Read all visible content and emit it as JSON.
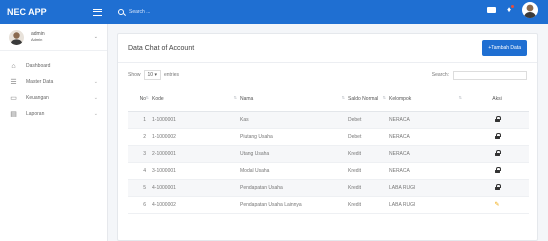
{
  "header": {
    "app_name": "NEC APP",
    "search_placeholder": "Search ..."
  },
  "user": {
    "name": "admin",
    "role": "Admin"
  },
  "sidebar": {
    "items": [
      {
        "label": "Dashboard",
        "icon": "home-icon",
        "has_caret": false
      },
      {
        "label": "Master Data",
        "icon": "database-icon",
        "has_caret": true
      },
      {
        "label": "Keuangan",
        "icon": "money-icon",
        "has_caret": true
      },
      {
        "label": "Laporan",
        "icon": "document-icon",
        "has_caret": true
      }
    ]
  },
  "card": {
    "title": "Data Chat of Account",
    "add_button": "+Tambah Data"
  },
  "table_tools": {
    "show_label": "Show",
    "length_value": "10",
    "entries_label": "entries",
    "search_label": "Search:"
  },
  "table": {
    "headers": [
      "No",
      "Kode",
      "Nama",
      "Saldo Normal",
      "Kelompok",
      "Aksi"
    ],
    "rows": [
      {
        "no": "1",
        "kode": "1-1000001",
        "nama": "Kas",
        "saldo": "Debet",
        "kelompok": "NERACA",
        "aksi": "lock"
      },
      {
        "no": "2",
        "kode": "1-1000002",
        "nama": "Piutang Usaha",
        "saldo": "Debet",
        "kelompok": "NERACA",
        "aksi": "lock"
      },
      {
        "no": "3",
        "kode": "2-1000001",
        "nama": "Utang Usaha",
        "saldo": "Kredit",
        "kelompok": "NERACA",
        "aksi": "lock"
      },
      {
        "no": "4",
        "kode": "3-1000001",
        "nama": "Modal Usaha",
        "saldo": "Kredit",
        "kelompok": "NERACA",
        "aksi": "lock"
      },
      {
        "no": "5",
        "kode": "4-1000001",
        "nama": "Pendapatan Usaha",
        "saldo": "Kredit",
        "kelompok": "LABA RUGI",
        "aksi": "lock"
      },
      {
        "no": "6",
        "kode": "4-1000002",
        "nama": "Pendapatan Usaha Lainnya",
        "saldo": "Kredit",
        "kelompok": "LABA RUGI",
        "aksi": "edit"
      }
    ]
  },
  "colors": {
    "primary": "#1f6fd2",
    "edit_icon": "#f0a500"
  }
}
